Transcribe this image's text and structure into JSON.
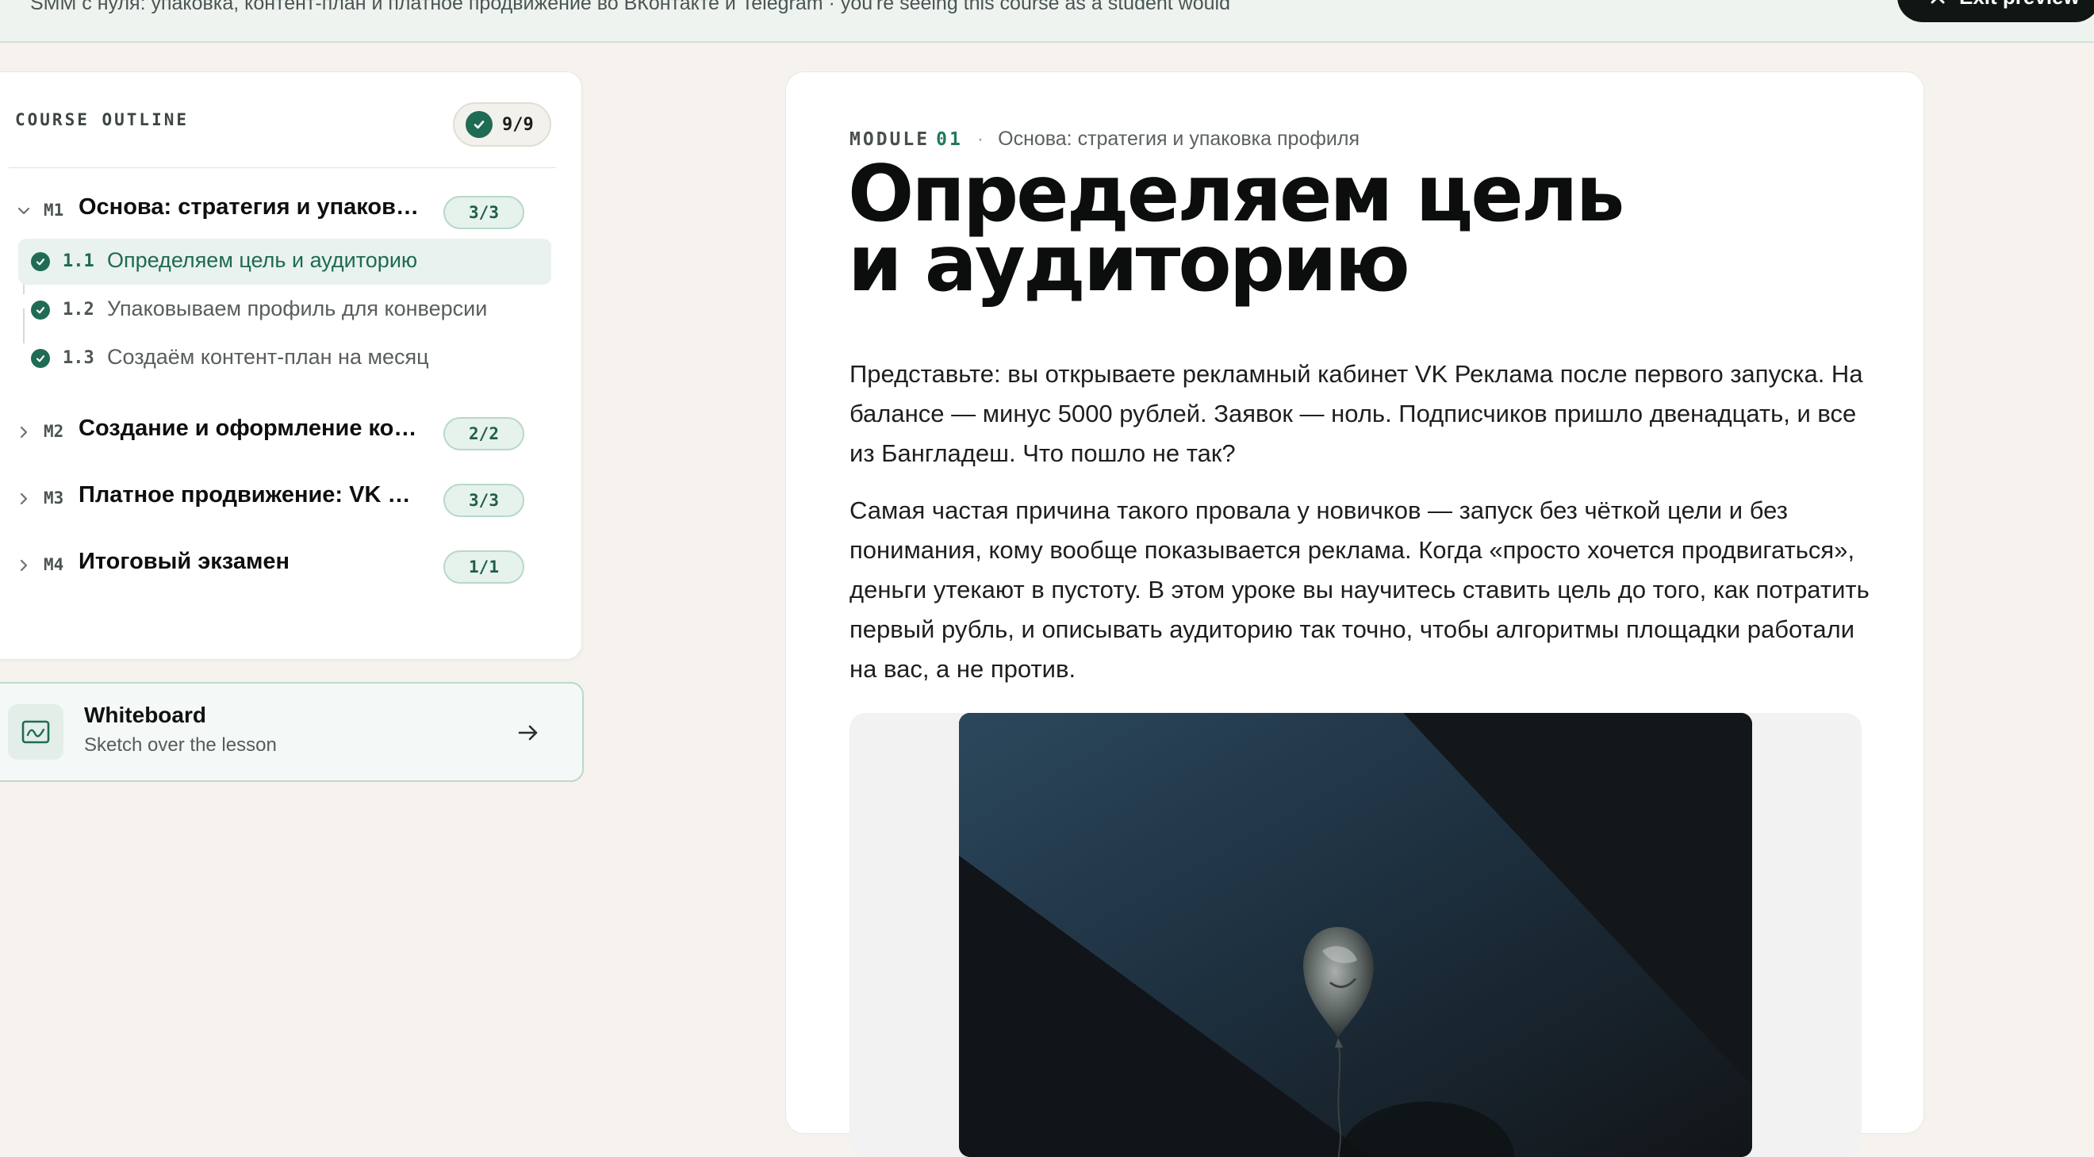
{
  "banner": {
    "text": "SMM с нуля: упаковка, контент-план и платное продвижение во ВКонтакте и Telegram · you're seeing this course as a student would",
    "exit_label": "Exit preview"
  },
  "outline": {
    "title": "COURSE OUTLINE",
    "total": "9/9",
    "modules": [
      {
        "code": "M1",
        "title": "Основа: стратегия и упаковка профиля",
        "count": "3/3",
        "expanded": true,
        "lessons": [
          {
            "num": "1.1",
            "title": "Определяем цель и аудиторию",
            "active": true,
            "done": true
          },
          {
            "num": "1.2",
            "title": "Упаковываем профиль для конверсии",
            "active": false,
            "done": true
          },
          {
            "num": "1.3",
            "title": "Создаём контент-план на месяц",
            "active": false,
            "done": true
          }
        ]
      },
      {
        "code": "M2",
        "title": "Создание и оформление контента",
        "count": "2/2",
        "expanded": false
      },
      {
        "code": "M3",
        "title": "Платное продвижение: VK Реклама и Telegram",
        "count": "3/3",
        "expanded": false
      },
      {
        "code": "M4",
        "title": "Итоговый экзамен",
        "count": "1/1",
        "expanded": false
      }
    ]
  },
  "whiteboard": {
    "title": "Whiteboard",
    "subtitle": "Sketch over the lesson",
    "icon": "whiteboard-icon"
  },
  "lesson": {
    "module_label": "MODULE",
    "module_number": "01",
    "module_name": "Основа: стратегия и упаковка профиля",
    "title_line1": "Определяем цель",
    "title_line2": "и аудиторию",
    "paragraphs": [
      "Представьте: вы открываете рекламный кабинет VK Реклама после первого запуска. На балансе — минус 5000 рублей. Заявок — ноль. Подписчиков пришло двенадцать, и все из Бангладеш. Что пошло не так?",
      "Самая частая причина такого провала у новичков — запуск без чёткой цели и без понимания, кому вообще показывается реклама. Когда «просто хочется продвигаться», деньги утекают в пустоту. В этом уроке вы научитесь ставить цель до того, как потратить первый рубль, и описывать аудиторию так точно, чтобы алгоритмы площадки работали на вас, а не против."
    ]
  },
  "colors": {
    "accent": "#1f6b54",
    "page_bg": "#f6f3ee",
    "pill_bg": "#e6f2ec"
  }
}
